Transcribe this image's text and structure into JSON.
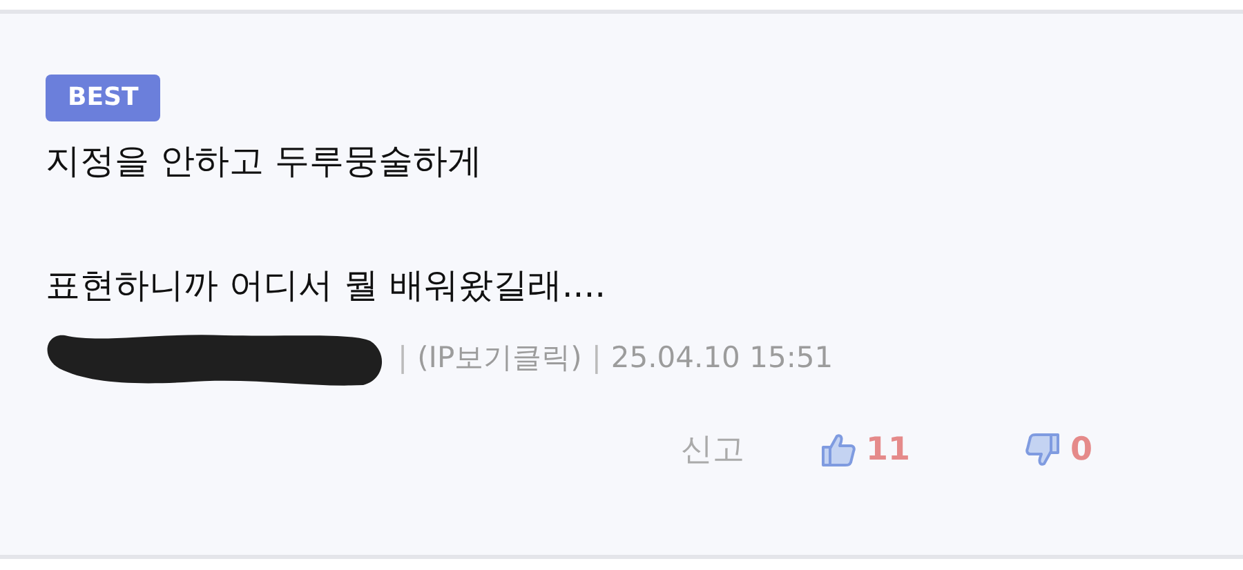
{
  "comment": {
    "badge": "BEST",
    "body": "지정을 안하고 두루뭉술하게\n\n표현하니까 어디서 뭘 배워왔길래....",
    "meta": [
      {
        "kind": "separator",
        "text": "|"
      },
      {
        "kind": "link",
        "text": "(IP보기클릭)"
      },
      {
        "kind": "separator",
        "text": "|"
      },
      {
        "kind": "date",
        "text": "25.04.10 15:51"
      }
    ],
    "report": "신고",
    "likes": "11",
    "dislikes": "0"
  }
}
